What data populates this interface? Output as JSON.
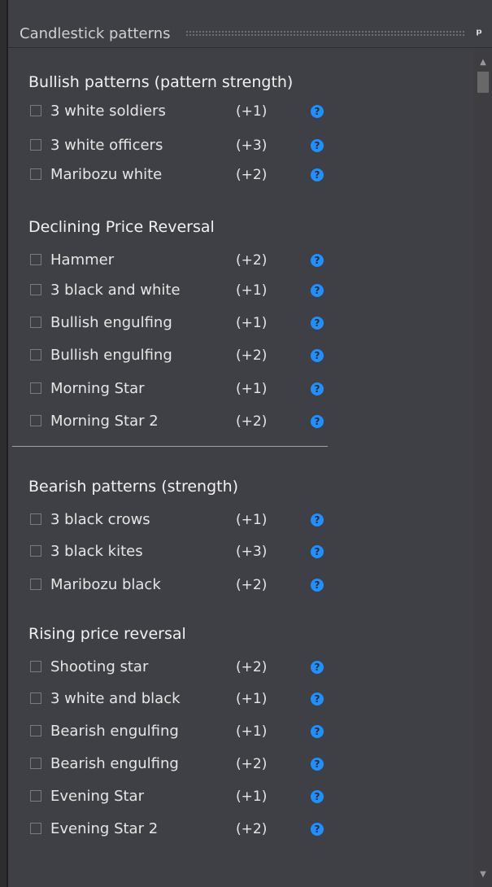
{
  "panel": {
    "title": "Candlestick patterns",
    "pin_glyph": "ᵖ"
  },
  "sections": [
    {
      "title": "Bullish patterns (pattern strength)",
      "items": [
        {
          "label": "3 white soldiers",
          "strength": "(+1)"
        },
        {
          "label": "3 white officers",
          "strength": "(+3)"
        },
        {
          "label": "Maribozu white",
          "strength": "(+2)"
        }
      ]
    },
    {
      "title": "Declining Price Reversal",
      "items": [
        {
          "label": "Hammer",
          "strength": "(+2)"
        },
        {
          "label": "3 black and white",
          "strength": "(+1)"
        },
        {
          "label": "Bullish engulfing",
          "strength": "(+1)"
        },
        {
          "label": "Bullish engulfing",
          "strength": "(+2)"
        },
        {
          "label": "Morning Star",
          "strength": "(+1)"
        },
        {
          "label": "Morning Star 2",
          "strength": "(+2)"
        }
      ]
    },
    {
      "title": "Bearish patterns (strength)",
      "items": [
        {
          "label": "3 black crows",
          "strength": "(+1)"
        },
        {
          "label": "3 black kites",
          "strength": "(+3)"
        },
        {
          "label": "Maribozu black",
          "strength": "(+2)"
        }
      ]
    },
    {
      "title": "Rising price reversal",
      "items": [
        {
          "label": "Shooting star",
          "strength": "(+2)"
        },
        {
          "label": "3 white and black",
          "strength": "(+1)"
        },
        {
          "label": "Bearish engulfing",
          "strength": "(+1)"
        },
        {
          "label": "Bearish engulfing",
          "strength": "(+2)"
        },
        {
          "label": "Evening Star",
          "strength": "(+1)"
        },
        {
          "label": "Evening Star 2",
          "strength": "(+2)"
        }
      ]
    }
  ],
  "help_glyph": "?",
  "icons": {
    "help": "help-icon",
    "pin": "pin-icon"
  },
  "colors": {
    "help_icon": "#1e90ff",
    "panel_bg": "#3f3f46"
  }
}
